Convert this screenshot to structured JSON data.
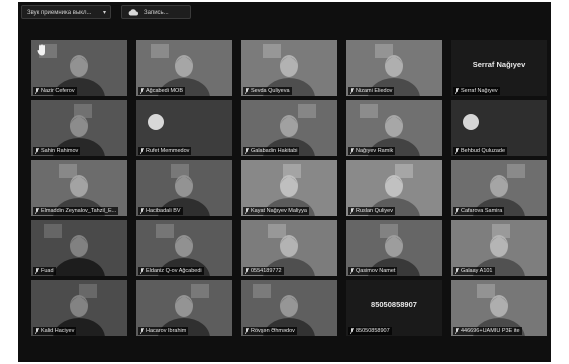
{
  "toolbar": {
    "audio_label": "Звук приемника выкл...",
    "record_label": "Запись..."
  },
  "tiles": [
    {
      "name": "Nazir Ceferov",
      "bg": "#5b5b5b",
      "face": true,
      "hand": true
    },
    {
      "name": "Ağcabedi MOB",
      "bg": "#6f6f6f",
      "face": true
    },
    {
      "name": "Sevda Quliyeva",
      "bg": "#7b7b7b",
      "face": true
    },
    {
      "name": "Nizami Eliedov",
      "bg": "#787878",
      "face": true
    },
    {
      "name": "Serraf Nağıyev",
      "bg": "#1a1a1a",
      "face": false,
      "big": "Serraf Nağıyev"
    },
    {
      "name": "Sahin Rahimov",
      "bg": "#555555",
      "face": true
    },
    {
      "name": "Rufet Memmedov",
      "bg": "#3d3d3d",
      "face": false,
      "lamp": true
    },
    {
      "name": "Galabadin Hakitabi",
      "bg": "#6a6a6a",
      "face": true
    },
    {
      "name": "Nağıyev Ramik",
      "bg": "#707070",
      "face": true
    },
    {
      "name": "Behbud Quluzade",
      "bg": "#2e2e2e",
      "face": false,
      "lamp": true
    },
    {
      "name": "Elmaddin Zeynalov_Tahzil_E...",
      "bg": "#6c6c6c",
      "face": true
    },
    {
      "name": "Hacibadali BV",
      "bg": "#5c5c5c",
      "face": true
    },
    {
      "name": "Kayat Nağıyev Maliyya",
      "bg": "#888888",
      "face": true
    },
    {
      "name": "Ruslan Quliyev",
      "bg": "#8a8a8a",
      "face": true
    },
    {
      "name": "Cafarova Samira",
      "bg": "#6e6e6e",
      "face": true
    },
    {
      "name": "Fuad",
      "bg": "#4a4a4a",
      "face": true
    },
    {
      "name": "Eldaniz Q-ov Ağcabedi",
      "bg": "#5a5a5a",
      "face": true
    },
    {
      "name": "0554189772",
      "bg": "#7c7c7c",
      "face": true
    },
    {
      "name": "Qasimov Namet",
      "bg": "#666666",
      "face": true
    },
    {
      "name": "Galaay A101",
      "bg": "#7e7e7e",
      "face": true
    },
    {
      "name": "Kalid Haciyev",
      "bg": "#4c4c4c",
      "face": true
    },
    {
      "name": "Hacarov Ibrahim",
      "bg": "#5d5d5d",
      "face": true
    },
    {
      "name": "Rövşən Əhmədov",
      "bg": "#5f5f5f",
      "face": true,
      "active": true
    },
    {
      "name": "85050858907",
      "bg": "#1a1a1a",
      "face": false,
      "big": "85050858907"
    },
    {
      "name": "446696+UAMIU P3E ite",
      "bg": "#777777",
      "face": true
    }
  ]
}
